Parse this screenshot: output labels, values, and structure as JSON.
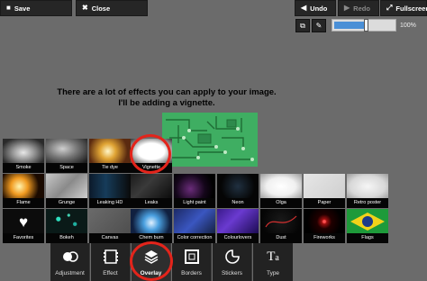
{
  "toolbar": {
    "save_label": "Save",
    "close_label": "Close",
    "undo_label": "Undo",
    "redo_label": "Redo",
    "fullscreen_label": "Fullscreen",
    "zoom_value": 100,
    "zoom_label": "100%",
    "zoom_fraction": 0.52
  },
  "caption": "There are a lot of effects you can apply to your image. I'll be adding a vignette.",
  "effects": {
    "row1": [
      "Smoke",
      "Space",
      "Tie dye",
      "Vignette"
    ],
    "row2": [
      "Flame",
      "Grunge",
      "Leaking HD",
      "Leaks",
      "Light paint",
      "Neon",
      "Olga",
      "Paper",
      "Retro poster"
    ],
    "row3": [
      "Favorites",
      "Bokeh",
      "Canvas",
      "Chem burn",
      "Color correction",
      "Colourlovers",
      "Dust",
      "Fireworks",
      "Flags"
    ]
  },
  "tools": [
    "Adjustment",
    "Effect",
    "Overlay",
    "Borders",
    "Stickers",
    "Type"
  ],
  "active_tool": "Overlay",
  "highlight_color": "#e3241b",
  "accent_color": "#4a8fd6"
}
